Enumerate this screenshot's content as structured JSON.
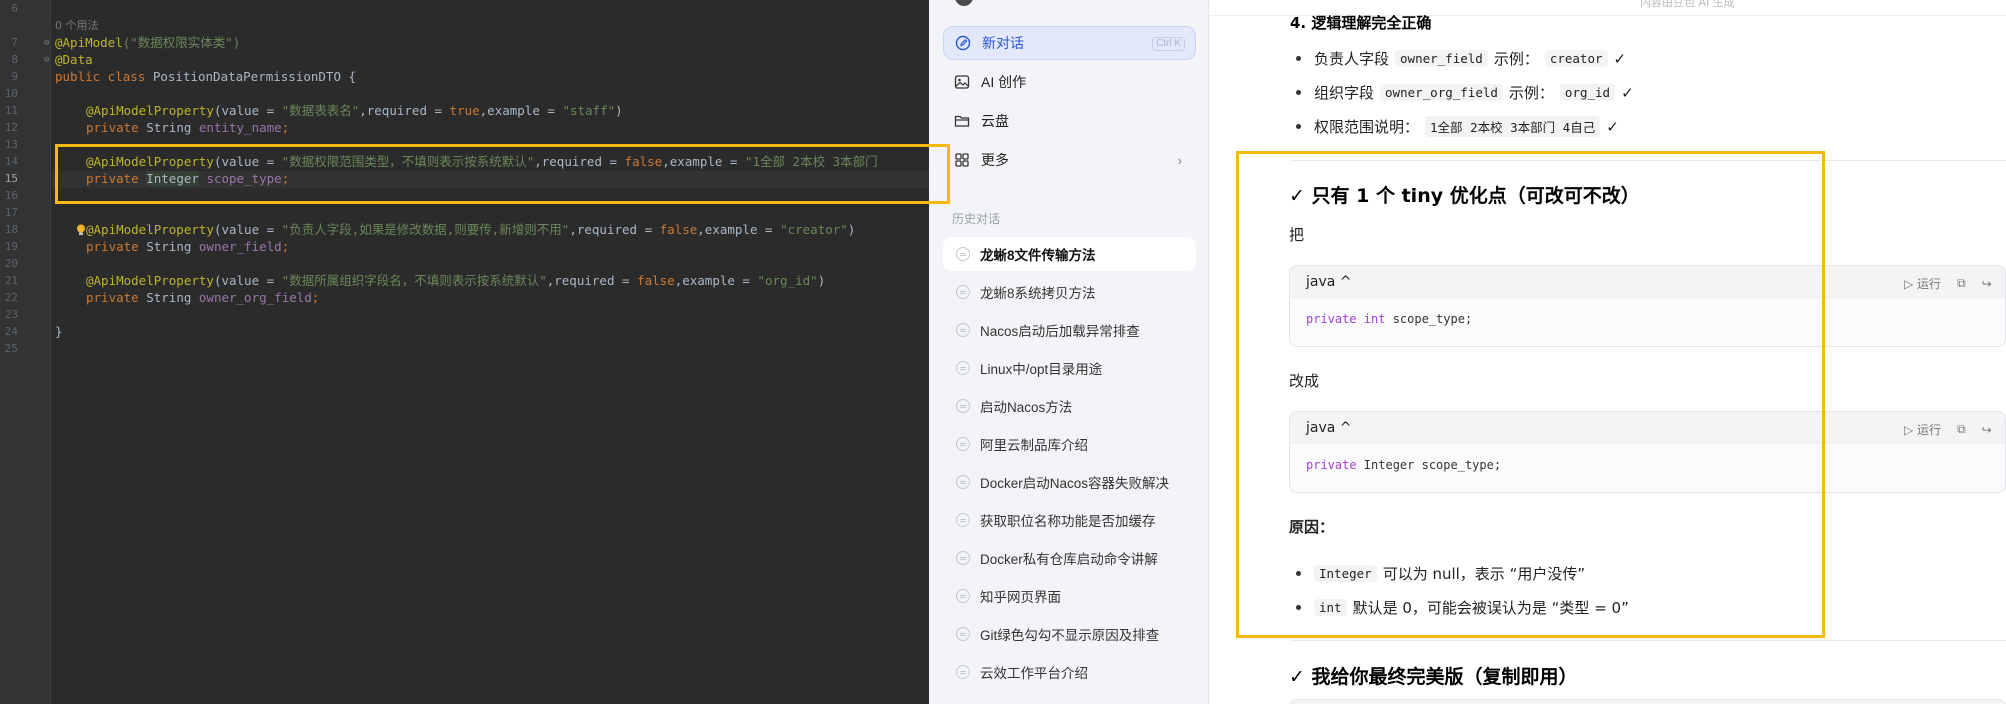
{
  "ide": {
    "usage_hint": "0 个用法",
    "line_numbers": [
      "6",
      "7",
      "8",
      "9",
      "10",
      "11",
      "12",
      "13",
      "14",
      "15",
      "16",
      "17",
      "18",
      "19",
      "20",
      "21",
      "22",
      "23",
      "24",
      "25"
    ],
    "lines": {
      "l7": "(\"数据权限实体类\")",
      "l7_ann": "@ApiModel",
      "l8_ann": "@Data",
      "l9_kw": "public class ",
      "l9_name": "PositionDataPermissionDTO {",
      "l11_ann": "@ApiModelProperty",
      "l11_a": "(value = ",
      "l11_s1": "\"数据表表名\"",
      "l11_b": ",required = ",
      "l11_k": "true",
      "l11_c": ",example = ",
      "l11_s2": "\"staff\"",
      "l11_d": ")",
      "l12_kw": "private ",
      "l12_type": "String ",
      "l12_field": "entity_name",
      "l12_end": ";",
      "l14_ann": "@ApiModelProperty",
      "l14_a": "(value = ",
      "l14_s1": "\"数据权限范围类型，不填则表示按系统默认\"",
      "l14_b": ",required = ",
      "l14_k": "false",
      "l14_c": ",example = ",
      "l14_s2": "\"1全部 2本校 3本部门",
      "l15_kw": "private ",
      "l15_type": "Integer",
      "l15_sp": " ",
      "l15_field": "scope_type",
      "l15_end": ";",
      "l18_ann": "@ApiModelProperty",
      "l18_a": "(value = ",
      "l18_s1": "\"负责人字段,如果是修改数据,则要传,新增则不用\"",
      "l18_b": ",required = ",
      "l18_k": "false",
      "l18_c": ",example = ",
      "l18_s2": "\"creator\"",
      "l18_d": ")",
      "l19_kw": "private ",
      "l19_type": "String ",
      "l19_field": "owner_field",
      "l19_end": ";",
      "l21_ann": "@ApiModelProperty",
      "l21_a": "(value = ",
      "l21_s1": "\"数据所属组织字段名，不填则表示按系统默认\"",
      "l21_b": ",required = ",
      "l21_k": "false",
      "l21_c": ",example = ",
      "l21_s2": "\"org_id\"",
      "l21_d": ")",
      "l22_kw": "private ",
      "l22_type": "String ",
      "l22_field": "owner_org_field",
      "l22_end": ";",
      "l24": "}"
    },
    "colors": {
      "background": "#2b2b2b",
      "annotation": "#bbb529",
      "keyword": "#cc7832",
      "string": "#6a8759",
      "field": "#9876aa",
      "highlight_box": "#f5b90f"
    }
  },
  "sidebar": {
    "new_chat": "新对话",
    "new_chat_shortcut": "Ctrl K",
    "ai_create": "AI 创作",
    "cloud": "云盘",
    "more": "更多",
    "history_label": "历史对话",
    "history": [
      "龙蜥8文件传输方法",
      "龙蜥8系统拷贝方法",
      "Nacos启动后加载异常排查",
      "Linux中/opt目录用途",
      "启动Nacos方法",
      "阿里云制品库介绍",
      "Docker启动Nacos容器失败解决",
      "获取职位名称功能是否加缓存",
      "Docker私有仓库启动命令讲解",
      "知乎网页界面",
      "Git绿色勾勾不显示原因及排查",
      "云效工作平台介绍"
    ],
    "active_color": "#2a56d6"
  },
  "main": {
    "top_hint": "内容由豆包 AI 生成",
    "section4_title": "4. 逻辑理解完全正确",
    "bullets_top": [
      {
        "pre": "负责人字段",
        "code": "owner_field",
        "mid": "示例：",
        "code2": "creator",
        "post": "✓"
      },
      {
        "pre": "组织字段",
        "code": "owner_org_field",
        "mid": "示例：",
        "code2": "org_id",
        "post": "✓"
      },
      {
        "pre": "权限范围说明：",
        "code": "1全部 2本校 3本部门 4自己",
        "mid": "",
        "code2": "",
        "post": "✓"
      }
    ],
    "tiny_title": "✓ 只有 1 个 tiny 优化点（可改可不改）",
    "ba": "把",
    "code1": {
      "lang": "java",
      "run": "运行",
      "kw": "private int",
      "rest": " scope_type;"
    },
    "gaicheng": "改成",
    "code2": {
      "lang": "java",
      "run": "运行",
      "kw": "private",
      "rest": " Integer scope_type;"
    },
    "reason_title": "原因：",
    "reasons": [
      {
        "code": "Integer",
        "text": "可以为 null，表示 “用户没传”"
      },
      {
        "code": "int",
        "text": "默认是 0，可能会被误认为是 “类型 = 0”"
      }
    ],
    "final_title": "✓ 我给你最终完美版（复制即用）"
  }
}
